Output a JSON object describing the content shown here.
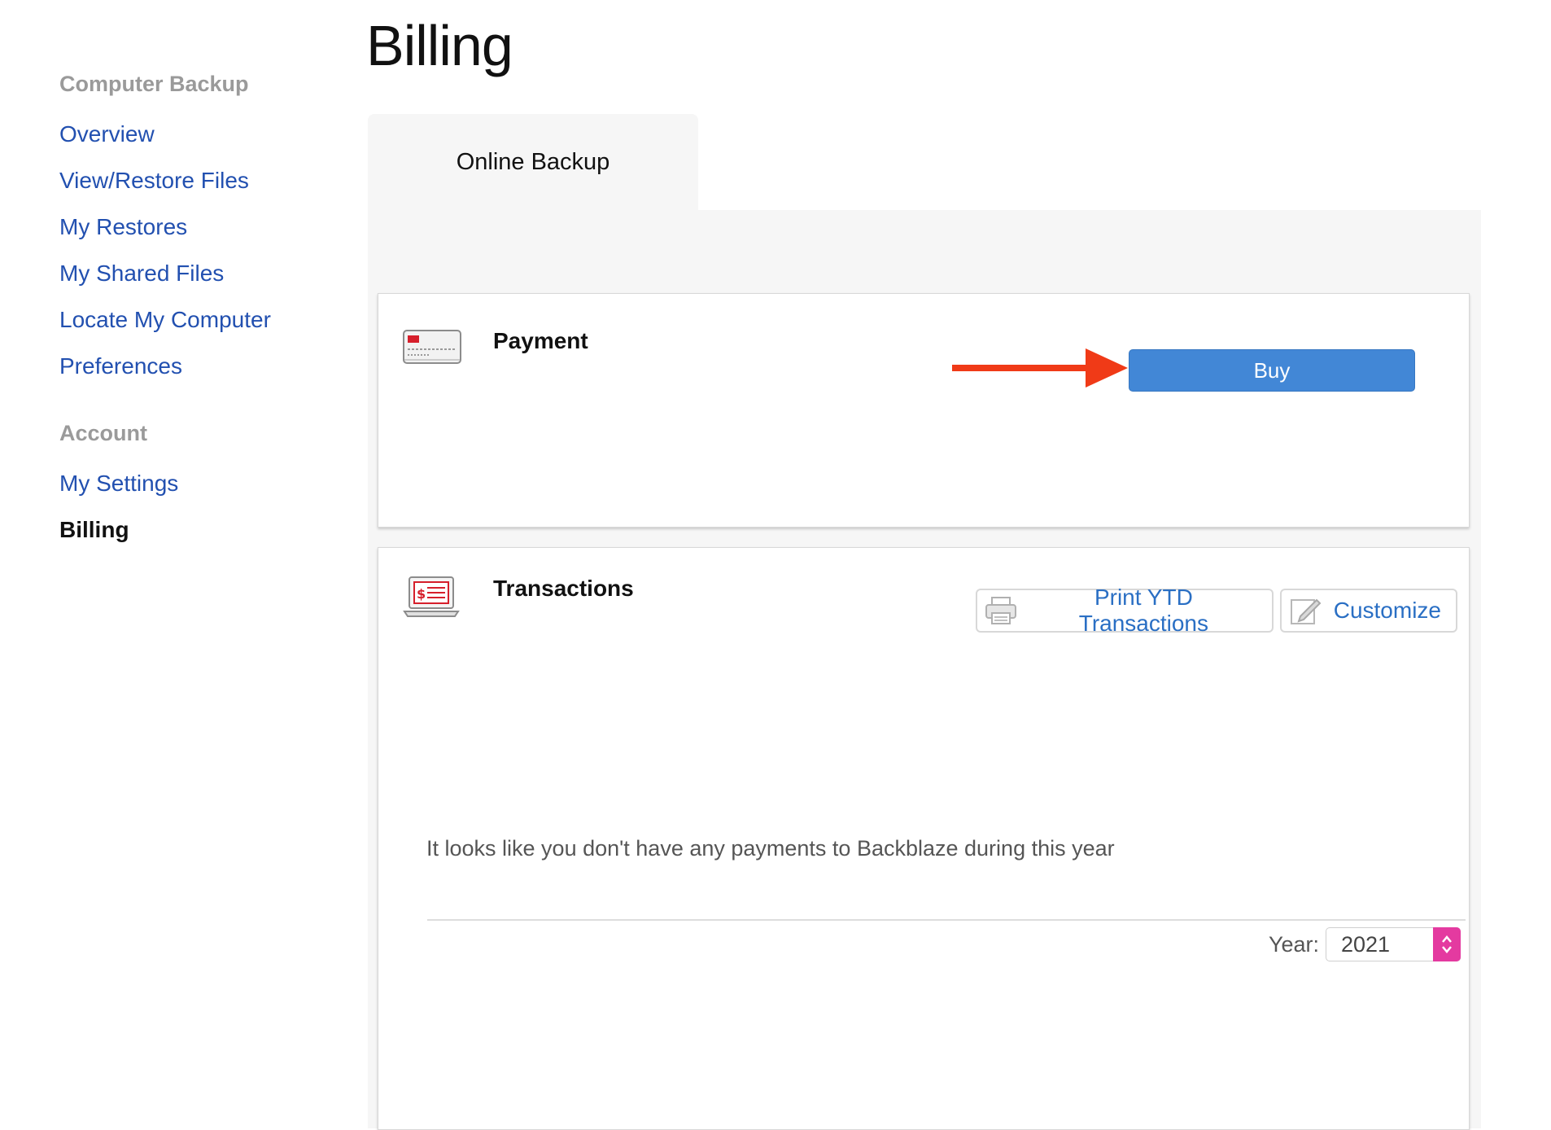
{
  "page": {
    "title": "Billing"
  },
  "sidebar": {
    "groups": [
      {
        "heading": "Computer Backup",
        "items": [
          {
            "label": "Overview"
          },
          {
            "label": "View/Restore Files"
          },
          {
            "label": "My Restores"
          },
          {
            "label": "My Shared Files"
          },
          {
            "label": "Locate My Computer"
          },
          {
            "label": "Preferences"
          }
        ]
      },
      {
        "heading": "Account",
        "items": [
          {
            "label": "My Settings"
          },
          {
            "label": "Billing",
            "active": true
          }
        ]
      }
    ]
  },
  "tabs": [
    {
      "label": "Online Backup",
      "active": true
    }
  ],
  "payment": {
    "title": "Payment",
    "icon": "credit-card-icon",
    "buy_label": "Buy"
  },
  "transactions": {
    "title": "Transactions",
    "icon": "laptop-invoice-icon",
    "print_label": "Print YTD Transactions",
    "customize_label": "Customize",
    "empty_message": "It looks like you don't have any payments to Backblaze during this year",
    "year_label": "Year:",
    "year_value": "2021"
  },
  "colors": {
    "link": "#2250b0",
    "buy_button": "#4287d6",
    "annotation_arrow": "#f03a17",
    "stepper": "#e43aa0"
  }
}
